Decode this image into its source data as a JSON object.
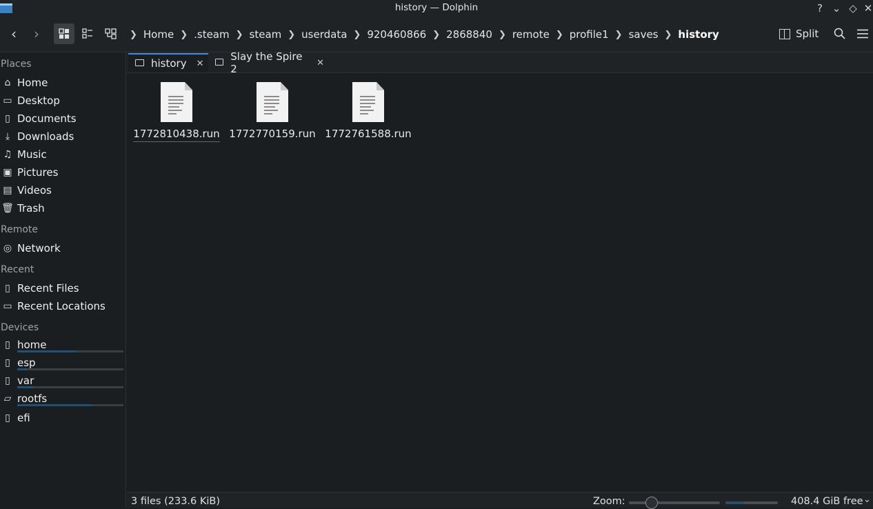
{
  "window": {
    "title": "history — Dolphin"
  },
  "toolbar": {
    "breadcrumb": [
      "Home",
      ".steam",
      "steam",
      "userdata",
      "920460866",
      "2868840",
      "remote",
      "profile1",
      "saves",
      "history"
    ],
    "split_label": "Split"
  },
  "sidebar": {
    "places_heading": "Places",
    "places": [
      {
        "label": "Home",
        "icon": "home-icon"
      },
      {
        "label": "Desktop",
        "icon": "desktop-icon"
      },
      {
        "label": "Documents",
        "icon": "documents-icon"
      },
      {
        "label": "Downloads",
        "icon": "downloads-icon"
      },
      {
        "label": "Music",
        "icon": "music-icon"
      },
      {
        "label": "Pictures",
        "icon": "pictures-icon"
      },
      {
        "label": "Videos",
        "icon": "videos-icon"
      },
      {
        "label": "Trash",
        "icon": "trash-icon"
      }
    ],
    "remote_heading": "Remote",
    "remote": [
      {
        "label": "Network",
        "icon": "network-icon"
      }
    ],
    "recent_heading": "Recent",
    "recent": [
      {
        "label": "Recent Files",
        "icon": "recent-files-icon"
      },
      {
        "label": "Recent Locations",
        "icon": "recent-locations-icon"
      }
    ],
    "devices_heading": "Devices",
    "devices": [
      {
        "label": "home",
        "icon": "drive-icon",
        "usage": 0.56
      },
      {
        "label": "esp",
        "icon": "drive-icon",
        "usage": 0.1
      },
      {
        "label": "var",
        "icon": "drive-icon",
        "usage": 0.15
      },
      {
        "label": "rootfs",
        "icon": "drive-icon",
        "usage": 0.7
      },
      {
        "label": "efi",
        "icon": "drive-icon"
      }
    ]
  },
  "tabs": [
    {
      "label": "history",
      "active": true
    },
    {
      "label": "Slay the Spire 2",
      "active": false
    }
  ],
  "files": [
    {
      "name": "1772810438.run"
    },
    {
      "name": "1772770159.run"
    },
    {
      "name": "1772761588.run"
    }
  ],
  "statusbar": {
    "info": "3 files (233.6 KiB)",
    "zoom_label": "Zoom:",
    "free_space": "408.4 GiB free",
    "disk_usage": 0.35
  },
  "colors": {
    "accent": "#3d8ee0",
    "background": "#1b1e20",
    "toolbar": "#202326"
  }
}
